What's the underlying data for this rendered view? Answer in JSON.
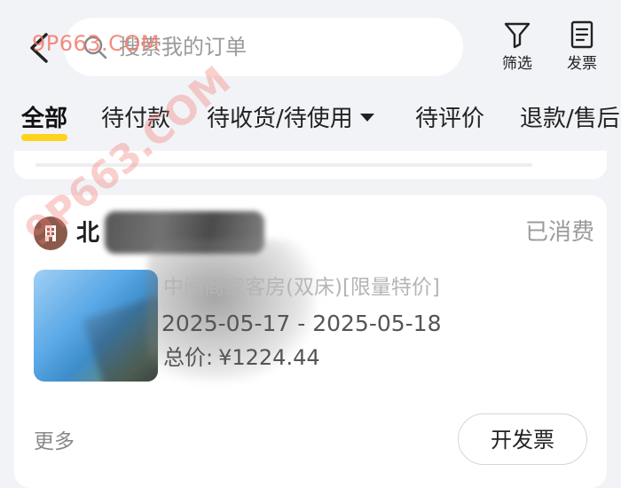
{
  "header": {
    "search_placeholder": "搜索我的订单",
    "filter_label": "筛选",
    "invoice_label": "发票"
  },
  "tabs": [
    {
      "label": "全部",
      "active": true
    },
    {
      "label": "待付款",
      "active": false
    },
    {
      "label": "待收货/待使用",
      "active": false,
      "has_dropdown": true
    },
    {
      "label": "待评价",
      "active": false
    },
    {
      "label": "退款/售后",
      "active": false
    }
  ],
  "order": {
    "shop_name": "北",
    "status": "已消费",
    "room_name": "中间商家客房(双床)[限量特价]",
    "dates": "2025-05-17 - 2025-05-18",
    "total_label": "总价:",
    "total_value": "¥1224.44",
    "more_label": "更多",
    "invoice_button": "开发票"
  },
  "watermark": {
    "text": "9P663.COM",
    "diagonal_text": "9P663.COM"
  },
  "colors": {
    "accent": "#ffd21e",
    "background": "#f2f3f7",
    "status_gray": "#9b9b9b",
    "shop_avatar": "#8c5a4d",
    "watermark": "#f07a6a"
  },
  "icons": {
    "back": "chevron-left-icon",
    "search": "search-icon",
    "filter": "filter-icon",
    "invoice": "receipt-icon",
    "shop": "building-icon"
  }
}
